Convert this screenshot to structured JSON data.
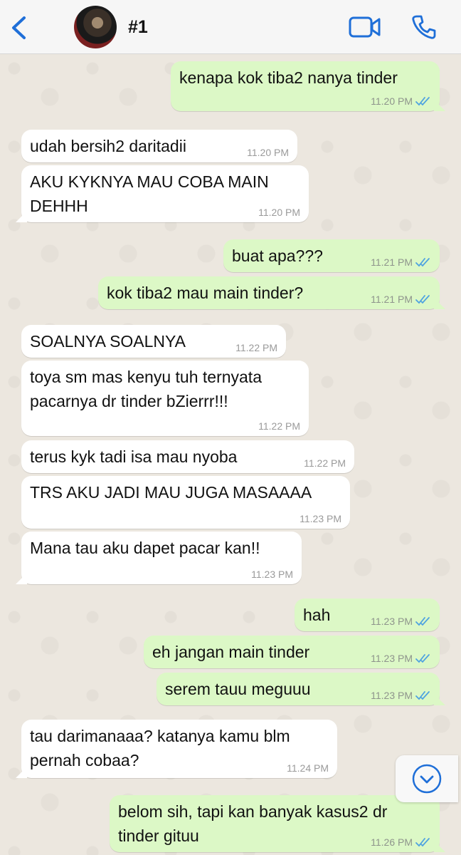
{
  "header": {
    "title": "#1",
    "accent_color": "#1f6fd8"
  },
  "messages": [
    {
      "dir": "out",
      "text": "kenapa kok tiba2 nanya tinder",
      "time": "11.20 PM",
      "read": true
    },
    {
      "dir": "in",
      "text": "udah bersih2 daritadii",
      "time": "11.20 PM"
    },
    {
      "dir": "in",
      "text": "AKU KYKNYA MAU COBA MAIN\nDEHHH",
      "time": "11.20 PM"
    },
    {
      "dir": "out",
      "text": "buat apa???",
      "time": "11.21 PM",
      "read": true
    },
    {
      "dir": "out",
      "text": "kok tiba2 mau main tinder?",
      "time": "11.21 PM",
      "read": true
    },
    {
      "dir": "in",
      "text": "SOALNYA SOALNYA",
      "time": "11.22 PM"
    },
    {
      "dir": "in",
      "text": "toya sm mas kenyu tuh ternyata\npacarnya dr tinder bZierrr!!!",
      "time": "11.22 PM"
    },
    {
      "dir": "in",
      "text": "terus kyk tadi isa mau nyoba",
      "time": "11.22 PM"
    },
    {
      "dir": "in",
      "text": "TRS AKU JADI MAU JUGA MASAAAA",
      "time": "11.23 PM"
    },
    {
      "dir": "in",
      "text": "Mana tau aku dapet pacar kan!!",
      "time": "11.23 PM"
    },
    {
      "dir": "out",
      "text": "hah",
      "time": "11.23 PM",
      "read": true
    },
    {
      "dir": "out",
      "text": "eh jangan main tinder",
      "time": "11.23 PM",
      "read": true
    },
    {
      "dir": "out",
      "text": "serem tauu meguuu",
      "time": "11.23 PM",
      "read": true
    },
    {
      "dir": "in",
      "text": "tau darimanaaa? katanya kamu blm\npernah cobaa?",
      "time": "11.24 PM"
    },
    {
      "dir": "out",
      "text": "belom sih, tapi kan banyak kasus2 dr\ntinder gituu",
      "time": "11.26 PM",
      "read": true
    }
  ],
  "colors": {
    "incoming_bubble": "#ffffff",
    "outgoing_bubble": "#dcf8c6",
    "read_ticks": "#4fa3e0",
    "chat_background": "#ece7df"
  },
  "icons": [
    "back-chevron-icon",
    "video-call-icon",
    "phone-call-icon",
    "scroll-down-icon",
    "read-ticks-icon"
  ]
}
